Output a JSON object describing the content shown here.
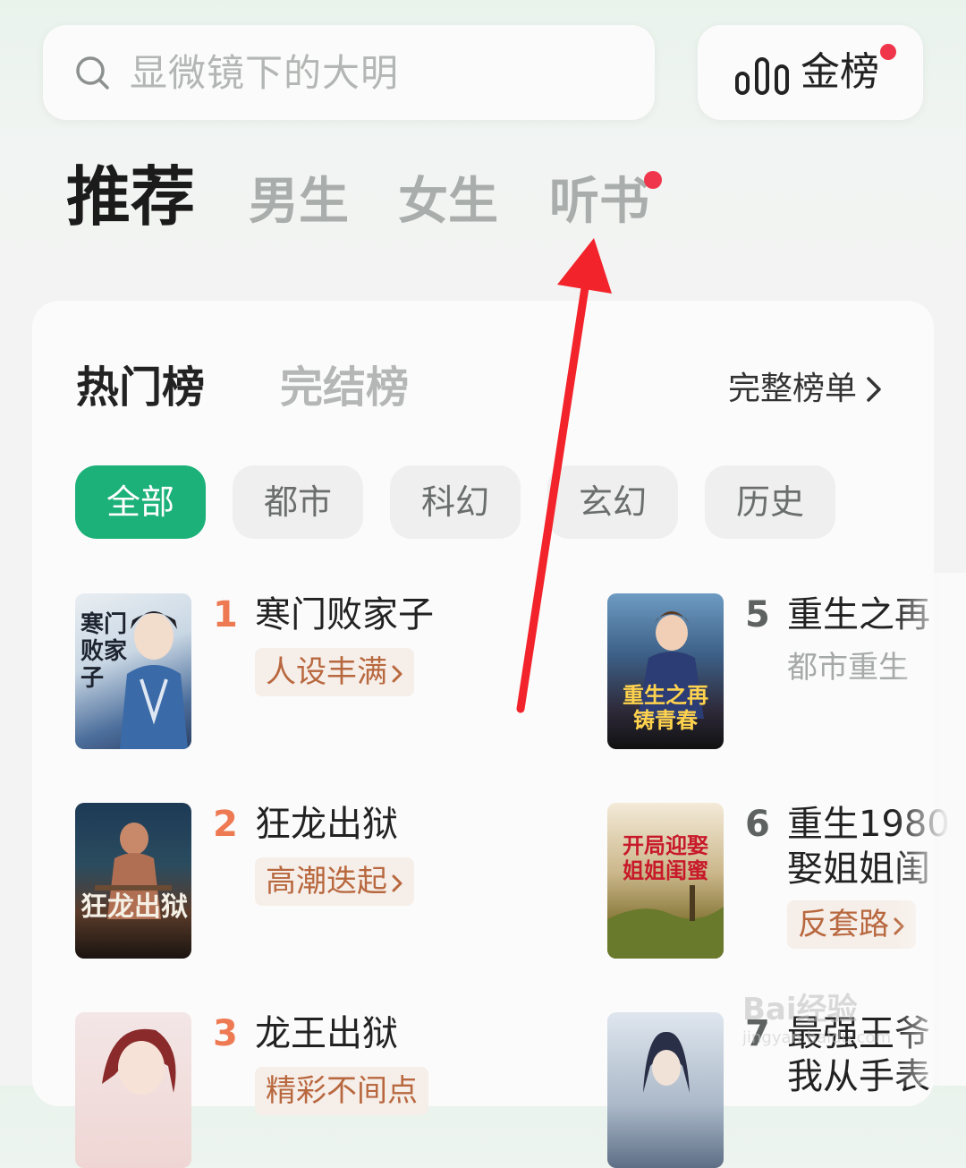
{
  "search": {
    "placeholder": "显微镜下的大明"
  },
  "gold_rank": {
    "label": "金榜",
    "has_dot": true
  },
  "top_tabs": [
    {
      "label": "推荐",
      "active": true
    },
    {
      "label": "男生",
      "active": false
    },
    {
      "label": "女生",
      "active": false
    },
    {
      "label": "听书",
      "active": false,
      "has_dot": true
    }
  ],
  "rank_tabs": [
    {
      "label": "热门榜",
      "active": true
    },
    {
      "label": "完结榜",
      "active": false
    }
  ],
  "full_list_label": "完整榜单",
  "genres": [
    {
      "label": "全部",
      "active": true
    },
    {
      "label": "都市",
      "active": false
    },
    {
      "label": "科幻",
      "active": false
    },
    {
      "label": "玄幻",
      "active": false
    },
    {
      "label": "历史",
      "active": false
    }
  ],
  "books_left": [
    {
      "rank": "1",
      "title": "寒门败家子",
      "tag": "人设丰满",
      "cover_text": "寒门败家子"
    },
    {
      "rank": "2",
      "title": "狂龙出狱",
      "tag": "高潮迭起",
      "cover_text": "狂龙出狱"
    },
    {
      "rank": "3",
      "title": "龙王出狱",
      "tag": "精彩不间点",
      "cover_text": ""
    }
  ],
  "books_right": [
    {
      "rank": "5",
      "title": "重生之再",
      "subtitle": "都市重生",
      "tag": "",
      "cover_text": "重生之再铸青春"
    },
    {
      "rank": "6",
      "title": "重生1980",
      "title_line2": "娶姐姐闺",
      "subtitle": "",
      "tag": "反套路",
      "cover_text": "开局迎娶姐姐闺蜜"
    },
    {
      "rank": "7",
      "title": "最强王爷",
      "title_line2": "我从手表",
      "subtitle": "",
      "tag": "",
      "cover_text": ""
    }
  ],
  "watermark": {
    "text": "Bai经验",
    "sub": "jingyan.baidu.com"
  },
  "colors": {
    "accent_green": "#1db17a",
    "badge_red": "#f0364b",
    "rank_orange": "#ee7a54",
    "arrow_red": "#f2232b"
  }
}
